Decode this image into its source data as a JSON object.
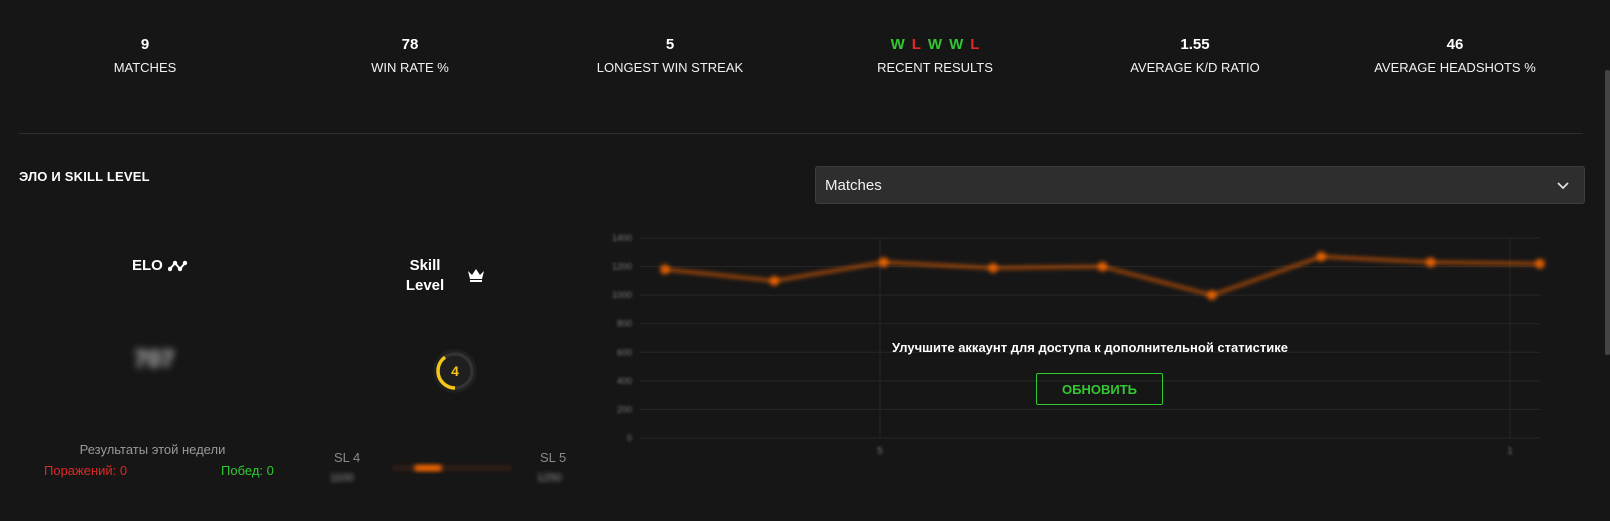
{
  "stats": [
    {
      "value": "9",
      "label": "MATCHES"
    },
    {
      "value": "78",
      "label": "WIN RATE %"
    },
    {
      "value": "5",
      "label": "LONGEST WIN STREAK"
    },
    {
      "value": "",
      "label": "RECENT RESULTS"
    },
    {
      "value": "1.55",
      "label": "AVERAGE K/D RATIO"
    },
    {
      "value": "46",
      "label": "AVERAGE HEADSHOTS %"
    }
  ],
  "recent_results": [
    "W",
    "L",
    "W",
    "W",
    "L"
  ],
  "section": {
    "title": "ЭЛО И SKILL LEVEL"
  },
  "select": {
    "value": "Matches",
    "icon": "chevron-down-icon"
  },
  "elo": {
    "label": "ELO",
    "value": "707",
    "icon": "elo-trend-icon"
  },
  "skill": {
    "label": "Skill Level",
    "level": "4",
    "icon": "crown-icon",
    "level_fraction": 0.4,
    "ring_color": "#f5c518"
  },
  "week": {
    "title": "Результаты этой недели",
    "losses": "Поражений: 0",
    "wins": "Побед: 0"
  },
  "sl_range": {
    "left_label": "SL 4",
    "right_label": "SL 5",
    "left_value": "1100",
    "right_value": "1250"
  },
  "chart_data": {
    "type": "line",
    "x": [
      1,
      2,
      3,
      4,
      5,
      6,
      7,
      8,
      9
    ],
    "values": [
      1180,
      1100,
      1230,
      1190,
      1200,
      1000,
      1270,
      1230,
      1220
    ],
    "ylim": [
      0,
      1400
    ],
    "yticks": [
      "0",
      "200",
      "400",
      "600",
      "800",
      "1000",
      "1200",
      "1400"
    ],
    "xticks": [
      "5",
      "1"
    ],
    "series_color": "#ff6a00",
    "blurred": true
  },
  "upgrade": {
    "message": "Улучшите аккаунт для доступа к дополнительной статистике",
    "button": "ОБНОВИТЬ"
  },
  "colors": {
    "win": "#32c832",
    "loss": "#e02828",
    "accent": "#ff6a00",
    "background": "#161616"
  }
}
